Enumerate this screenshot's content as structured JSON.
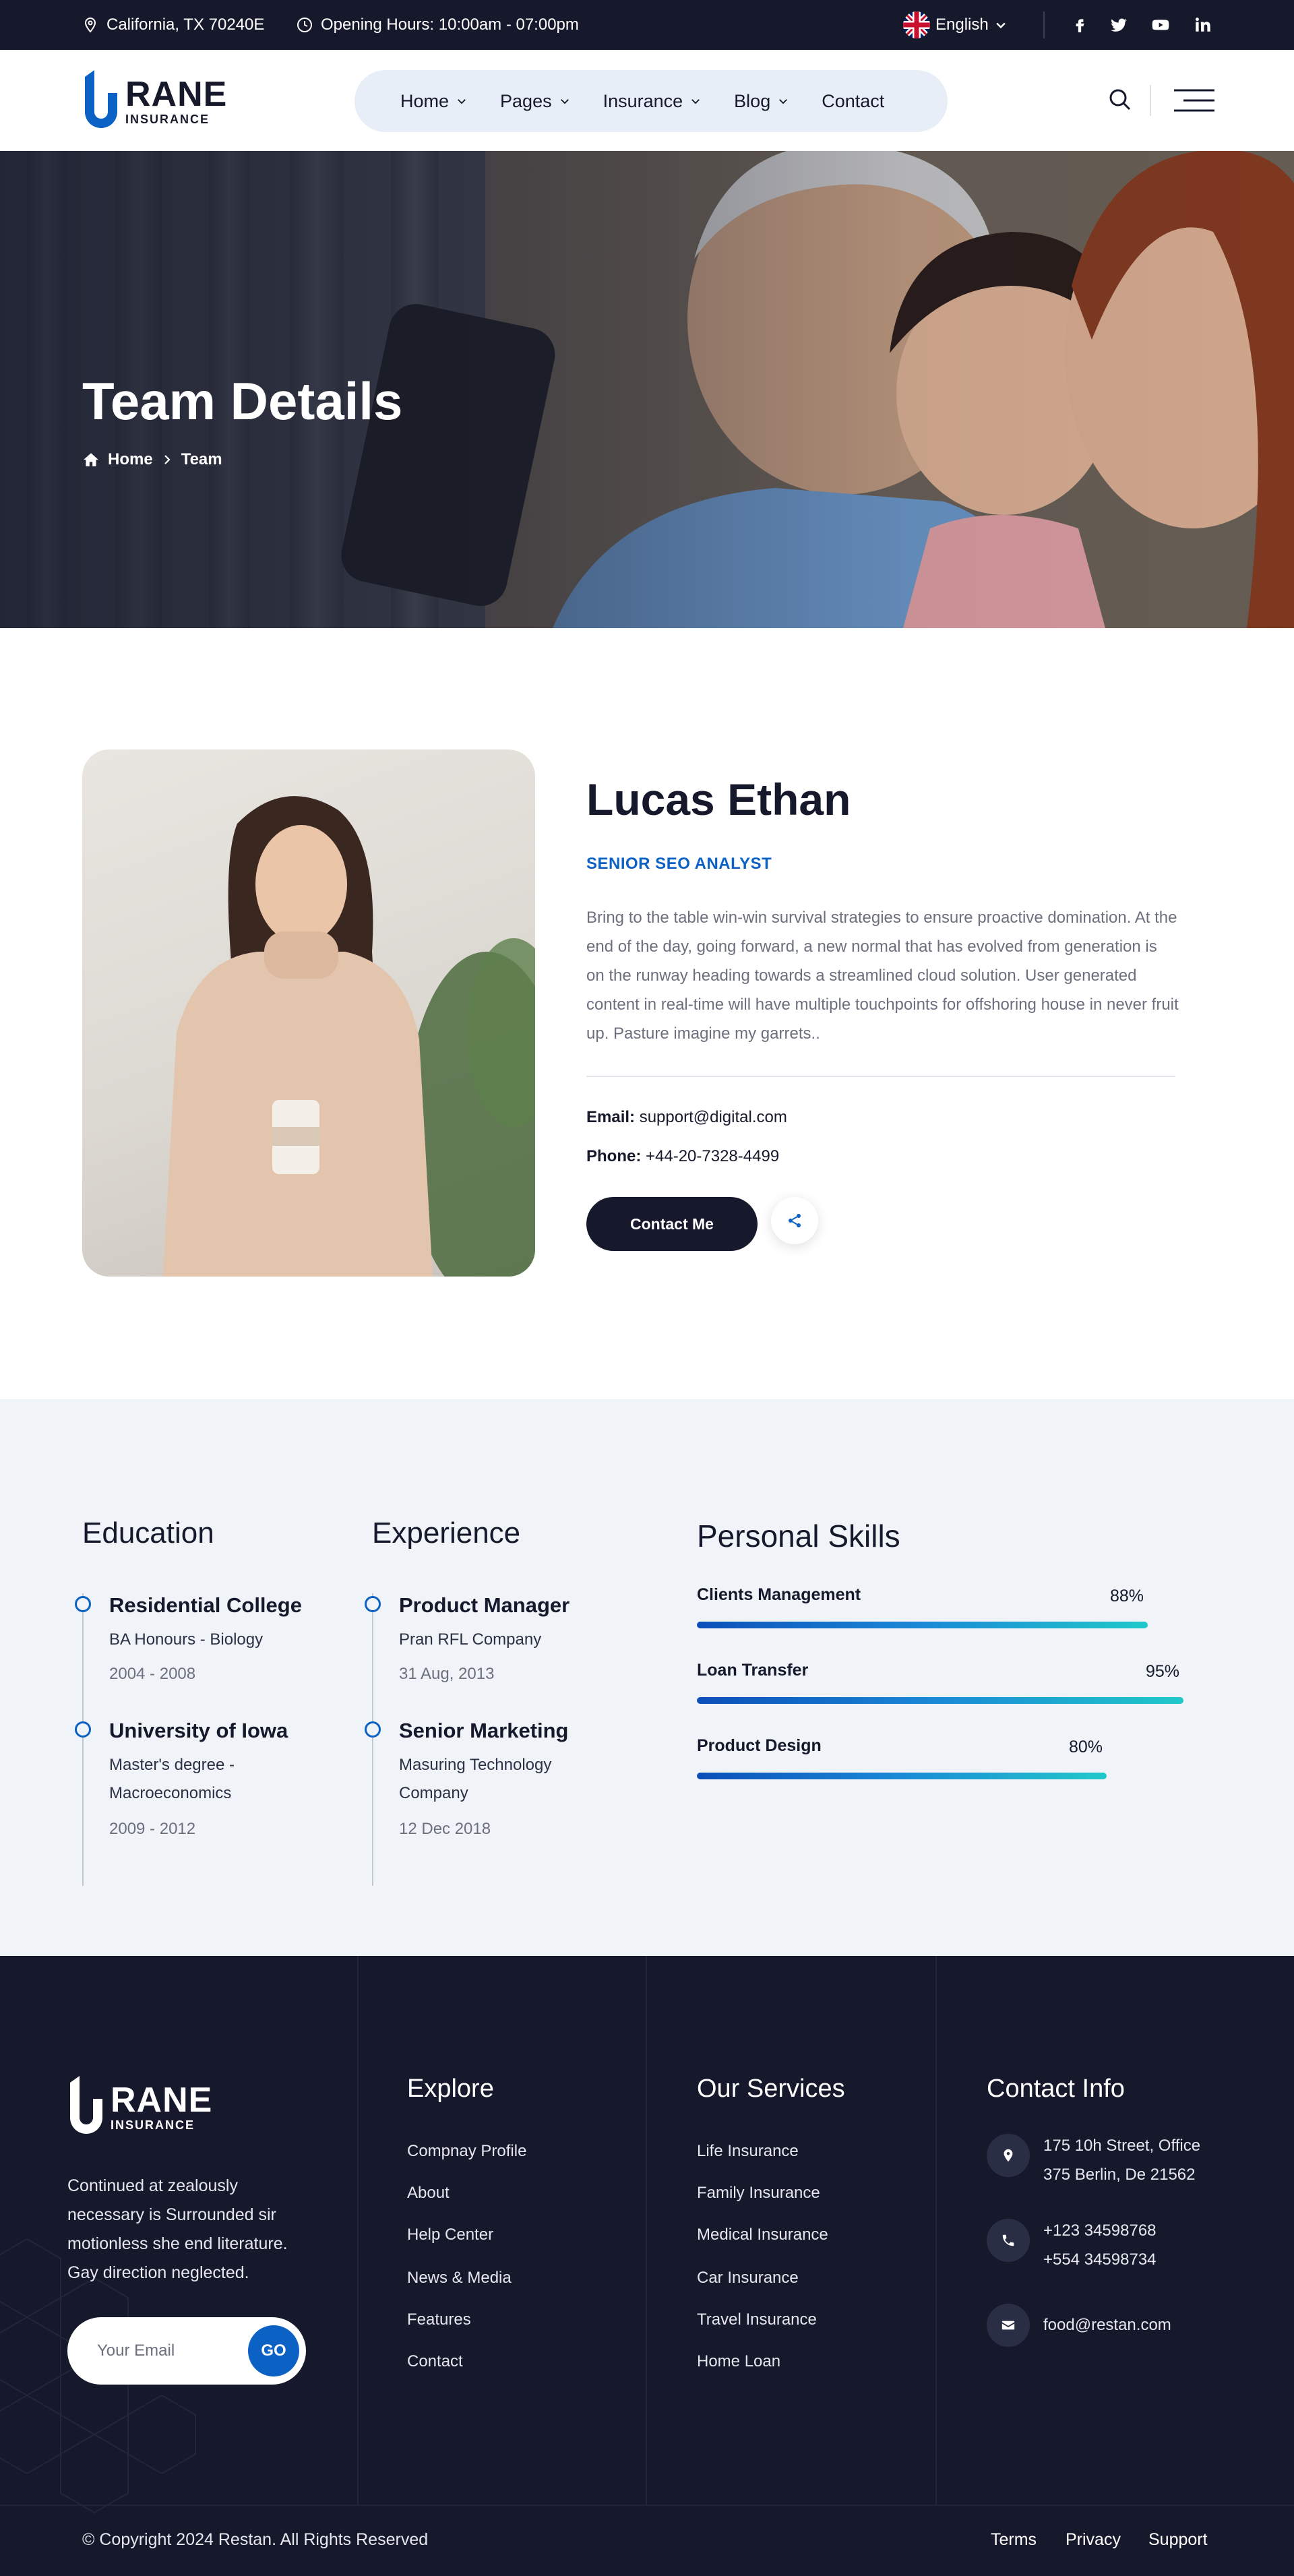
{
  "topbar": {
    "location": "California, TX 70240E",
    "hours": "Opening Hours: 10:00am - 07:00pm",
    "language": "English",
    "social_icons": [
      "facebook-icon",
      "twitter-icon",
      "youtube-icon",
      "linkedin-icon"
    ]
  },
  "header": {
    "logo_main": "RANE",
    "logo_sub": "INSURANCE",
    "nav": [
      {
        "label": "Home",
        "has_dropdown": true
      },
      {
        "label": "Pages",
        "has_dropdown": true
      },
      {
        "label": "Insurance",
        "has_dropdown": true
      },
      {
        "label": "Blog",
        "has_dropdown": true
      },
      {
        "label": "Contact",
        "has_dropdown": false
      }
    ]
  },
  "hero": {
    "title": "Team Details",
    "breadcrumb_home": "Home",
    "breadcrumb_current": "Team"
  },
  "member": {
    "name": "Lucas Ethan",
    "role": "SENIOR SEO ANALYST",
    "bio": "Bring to the table win-win survival strategies to ensure proactive domination. At the end of the day, going forward, a new normal that has evolved from generation is on the runway heading towards a streamlined cloud solution. User generated content in real-time will have multiple touchpoints for offshoring house in never fruit up. Pasture imagine my garrets..",
    "email_label": "Email:",
    "email": "support@digital.com",
    "phone_label": "Phone:",
    "phone": "+44-20-7328-4499",
    "contact_button": "Contact Me"
  },
  "education": {
    "title": "Education",
    "items": [
      {
        "title": "Residential College",
        "subtitle": "BA Honours - Biology",
        "date": "2004 - 2008"
      },
      {
        "title": "University of Iowa",
        "subtitle": "Master's degree - Macroeconomics",
        "date": "2009 - 2012"
      }
    ]
  },
  "experience": {
    "title": "Experience",
    "items": [
      {
        "title": "Product Manager",
        "subtitle": "Pran RFL Company",
        "date": "31 Aug, 2013"
      },
      {
        "title": "Senior Marketing",
        "subtitle": "Masuring Technology Company",
        "date": "12 Dec 2018"
      }
    ]
  },
  "skills": {
    "title": "Personal Skills",
    "items": [
      {
        "name": "Clients Management",
        "percent_label": "88%",
        "value": 88
      },
      {
        "name": "Loan Transfer",
        "percent_label": "95%",
        "value": 95
      },
      {
        "name": "Product Design",
        "percent_label": "80%",
        "value": 80
      }
    ]
  },
  "footer": {
    "logo_main": "RANE",
    "logo_sub": "INSURANCE",
    "about": "Continued at zealously necessary is Surrounded sir motionless she end literature. Gay direction neglected.",
    "email_placeholder": "Your Email",
    "go_label": "GO",
    "explore": {
      "title": "Explore",
      "links": [
        "Compnay Profile",
        "About",
        "Help Center",
        "News & Media",
        "Features",
        "Contact"
      ]
    },
    "services": {
      "title": "Our Services",
      "links": [
        "Life Insurance",
        "Family Insurance",
        "Medical Insurance",
        "Car Insurance",
        "Travel Insurance",
        "Home Loan"
      ]
    },
    "contact": {
      "title": "Contact Info",
      "address_line1": "175 10h Street, Office",
      "address_line2": "375 Berlin, De 21562",
      "phone_line1": "+123 34598768",
      "phone_line2": "+554 34598734",
      "email": "food@restan.com"
    },
    "copyright": "© Copyright 2024 Restan. All Rights Reserved",
    "bottom_links": [
      "Terms",
      "Privacy",
      "Support"
    ]
  },
  "colors": {
    "dark": "#16192c",
    "accent": "#0b62c4",
    "teal": "#20c9c9",
    "light_bg": "#f0f3f8",
    "nav_bg": "#e8eef7"
  }
}
